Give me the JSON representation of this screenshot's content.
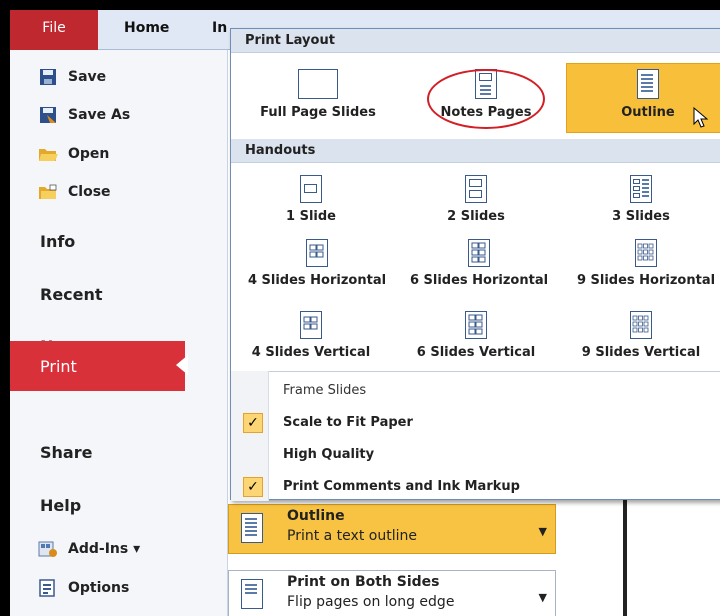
{
  "tabs": {
    "file": "File",
    "home": "Home",
    "insert_partial": "In"
  },
  "left_panel": {
    "commands": [
      {
        "label": "Save",
        "icon": "save-icon"
      },
      {
        "label": "Save As",
        "icon": "save-as-icon"
      },
      {
        "label": "Open",
        "icon": "open-folder-icon"
      },
      {
        "label": "Close",
        "icon": "close-folder-icon"
      }
    ],
    "nav": {
      "info": "Info",
      "recent": "Recent",
      "new": "New",
      "print": "Print",
      "share": "Share",
      "help": "Help"
    },
    "addins": "Add-Ins ▾",
    "options": "Options"
  },
  "menu": {
    "print_layout_header": "Print Layout",
    "layout_items": [
      "Full Page Slides",
      "Notes Pages",
      "Outline"
    ],
    "handouts_header": "Handouts",
    "handout_items": [
      "1 Slide",
      "2 Slides",
      "3 Slides",
      "4 Slides Horizontal",
      "6 Slides Horizontal",
      "9 Slides Horizontal",
      "4 Slides Vertical",
      "6 Slides Vertical",
      "9 Slides Vertical"
    ],
    "options": [
      {
        "label": "Frame Slides",
        "checked": false
      },
      {
        "label": "Scale to Fit Paper",
        "checked": true
      },
      {
        "label": "High Quality",
        "checked": false
      },
      {
        "label": "Print Comments and Ink Markup",
        "checked": true
      }
    ],
    "check_glyph": "✓"
  },
  "settings": {
    "layout": {
      "title": "Outline",
      "subtitle": "Print a text outline"
    },
    "sides": {
      "title": "Print on Both Sides",
      "subtitle": "Flip pages on long edge"
    }
  }
}
